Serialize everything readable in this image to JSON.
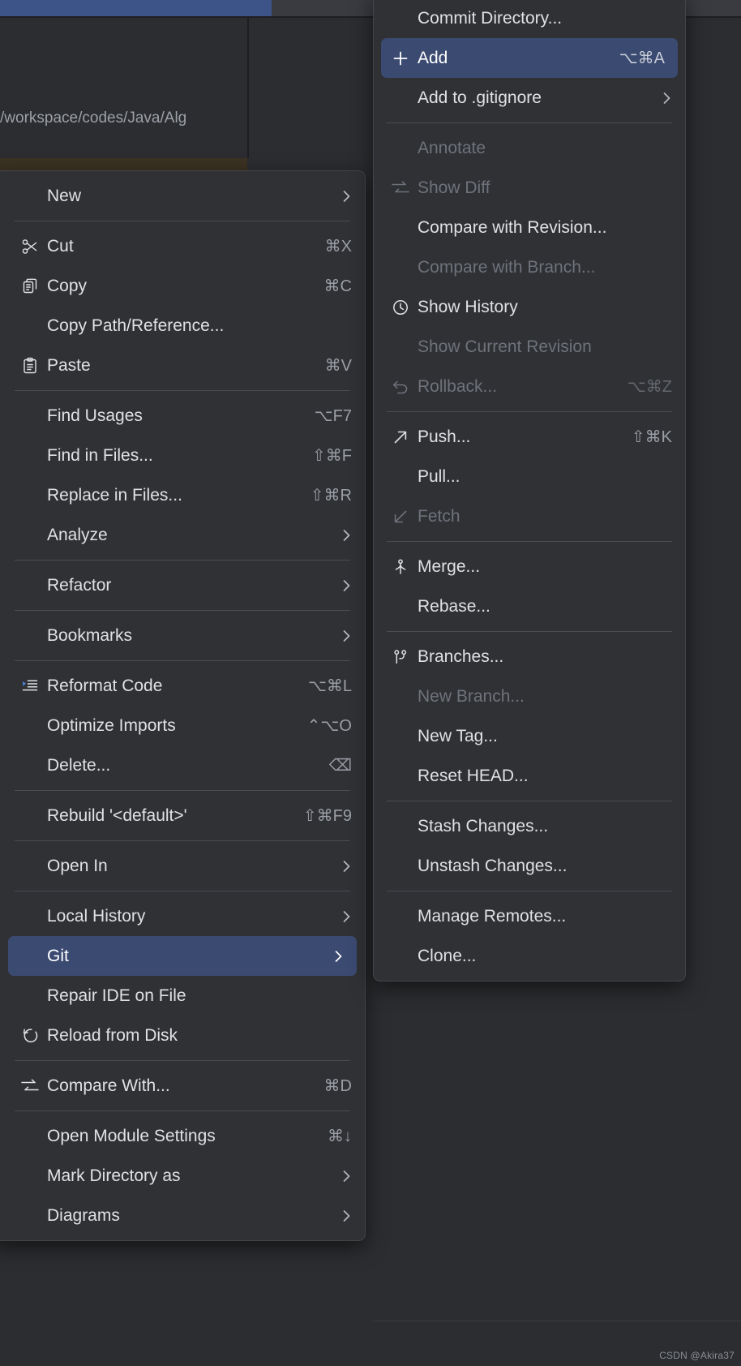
{
  "background": {
    "breadcrumb_path": "/workspace/codes/Java/Alg",
    "watermark": "CSDN @Akira37",
    "accent_color": "#3c5488",
    "editor_bg": "#2b2d30"
  },
  "context_menu": {
    "name": "editor-context-menu",
    "selected_item": "Git",
    "selection_color": "#3b4a71",
    "items": [
      {
        "label": "New",
        "shortcut": "",
        "icon": "",
        "arrow": true,
        "disabled": false,
        "selected": false
      },
      {
        "separator": true
      },
      {
        "label": "Cut",
        "shortcut": "⌘X",
        "icon": "scissors-icon",
        "arrow": false,
        "disabled": false,
        "selected": false
      },
      {
        "label": "Copy",
        "shortcut": "⌘C",
        "icon": "copy-icon",
        "arrow": false,
        "disabled": false,
        "selected": false
      },
      {
        "label": "Copy Path/Reference...",
        "shortcut": "",
        "icon": "",
        "arrow": false,
        "disabled": false,
        "selected": false
      },
      {
        "label": "Paste",
        "shortcut": "⌘V",
        "icon": "paste-icon",
        "arrow": false,
        "disabled": false,
        "selected": false
      },
      {
        "separator": true
      },
      {
        "label": "Find Usages",
        "shortcut": "⌥F7",
        "icon": "",
        "arrow": false,
        "disabled": false,
        "selected": false
      },
      {
        "label": "Find in Files...",
        "shortcut": "⇧⌘F",
        "icon": "",
        "arrow": false,
        "disabled": false,
        "selected": false
      },
      {
        "label": "Replace in Files...",
        "shortcut": "⇧⌘R",
        "icon": "",
        "arrow": false,
        "disabled": false,
        "selected": false
      },
      {
        "label": "Analyze",
        "shortcut": "",
        "icon": "",
        "arrow": true,
        "disabled": false,
        "selected": false
      },
      {
        "separator": true
      },
      {
        "label": "Refactor",
        "shortcut": "",
        "icon": "",
        "arrow": true,
        "disabled": false,
        "selected": false
      },
      {
        "separator": true
      },
      {
        "label": "Bookmarks",
        "shortcut": "",
        "icon": "",
        "arrow": true,
        "disabled": false,
        "selected": false
      },
      {
        "separator": true
      },
      {
        "label": "Reformat Code",
        "shortcut": "⌥⌘L",
        "icon": "reformat-icon",
        "arrow": false,
        "disabled": false,
        "selected": false
      },
      {
        "label": "Optimize Imports",
        "shortcut": "⌃⌥O",
        "icon": "",
        "arrow": false,
        "disabled": false,
        "selected": false
      },
      {
        "label": "Delete...",
        "shortcut": "⌫",
        "icon": "",
        "arrow": false,
        "disabled": false,
        "selected": false
      },
      {
        "separator": true
      },
      {
        "label": "Rebuild '<default>'",
        "shortcut": "⇧⌘F9",
        "icon": "",
        "arrow": false,
        "disabled": false,
        "selected": false
      },
      {
        "separator": true
      },
      {
        "label": "Open In",
        "shortcut": "",
        "icon": "",
        "arrow": true,
        "disabled": false,
        "selected": false
      },
      {
        "separator": true
      },
      {
        "label": "Local History",
        "shortcut": "",
        "icon": "",
        "arrow": true,
        "disabled": false,
        "selected": false
      },
      {
        "label": "Git",
        "shortcut": "",
        "icon": "",
        "arrow": true,
        "disabled": false,
        "selected": true
      },
      {
        "label": "Repair IDE on File",
        "shortcut": "",
        "icon": "",
        "arrow": false,
        "disabled": false,
        "selected": false
      },
      {
        "label": "Reload from Disk",
        "shortcut": "",
        "icon": "reload-icon",
        "arrow": false,
        "disabled": false,
        "selected": false
      },
      {
        "separator": true
      },
      {
        "label": "Compare With...",
        "shortcut": "⌘D",
        "icon": "diff-icon",
        "arrow": false,
        "disabled": false,
        "selected": false
      },
      {
        "separator": true
      },
      {
        "label": "Open Module Settings",
        "shortcut": "⌘↓",
        "icon": "",
        "arrow": false,
        "disabled": false,
        "selected": false
      },
      {
        "label": "Mark Directory as",
        "shortcut": "",
        "icon": "",
        "arrow": true,
        "disabled": false,
        "selected": false
      },
      {
        "label": "Diagrams",
        "shortcut": "",
        "icon": "",
        "arrow": true,
        "disabled": false,
        "selected": false
      }
    ]
  },
  "git_submenu": {
    "name": "git-submenu",
    "selected_item": "Add",
    "selection_color": "#3b4a71",
    "items": [
      {
        "label": "Commit Directory...",
        "shortcut": "",
        "icon": "",
        "arrow": false,
        "disabled": false,
        "selected": false
      },
      {
        "label": "Add",
        "shortcut": "⌥⌘A",
        "icon": "plus-icon",
        "arrow": false,
        "disabled": false,
        "selected": true
      },
      {
        "label": "Add to .gitignore",
        "shortcut": "",
        "icon": "",
        "arrow": true,
        "disabled": false,
        "selected": false
      },
      {
        "separator": true
      },
      {
        "label": "Annotate",
        "shortcut": "",
        "icon": "",
        "arrow": false,
        "disabled": true,
        "selected": false
      },
      {
        "label": "Show Diff",
        "shortcut": "",
        "icon": "diff-icon",
        "arrow": false,
        "disabled": true,
        "selected": false
      },
      {
        "label": "Compare with Revision...",
        "shortcut": "",
        "icon": "",
        "arrow": false,
        "disabled": false,
        "selected": false
      },
      {
        "label": "Compare with Branch...",
        "shortcut": "",
        "icon": "",
        "arrow": false,
        "disabled": true,
        "selected": false
      },
      {
        "label": "Show History",
        "shortcut": "",
        "icon": "clock-icon",
        "arrow": false,
        "disabled": false,
        "selected": false
      },
      {
        "label": "Show Current Revision",
        "shortcut": "",
        "icon": "",
        "arrow": false,
        "disabled": true,
        "selected": false
      },
      {
        "label": "Rollback...",
        "shortcut": "⌥⌘Z",
        "icon": "rollback-icon",
        "arrow": false,
        "disabled": true,
        "selected": false
      },
      {
        "separator": true
      },
      {
        "label": "Push...",
        "shortcut": "⇧⌘K",
        "icon": "push-icon",
        "arrow": false,
        "disabled": false,
        "selected": false
      },
      {
        "label": "Pull...",
        "shortcut": "",
        "icon": "",
        "arrow": false,
        "disabled": false,
        "selected": false
      },
      {
        "label": "Fetch",
        "shortcut": "",
        "icon": "fetch-icon",
        "arrow": false,
        "disabled": true,
        "selected": false
      },
      {
        "separator": true
      },
      {
        "label": "Merge...",
        "shortcut": "",
        "icon": "merge-icon",
        "arrow": false,
        "disabled": false,
        "selected": false
      },
      {
        "label": "Rebase...",
        "shortcut": "",
        "icon": "",
        "arrow": false,
        "disabled": false,
        "selected": false
      },
      {
        "separator": true
      },
      {
        "label": "Branches...",
        "shortcut": "",
        "icon": "branch-icon",
        "arrow": false,
        "disabled": false,
        "selected": false
      },
      {
        "label": "New Branch...",
        "shortcut": "",
        "icon": "",
        "arrow": false,
        "disabled": true,
        "selected": false
      },
      {
        "label": "New Tag...",
        "shortcut": "",
        "icon": "",
        "arrow": false,
        "disabled": false,
        "selected": false
      },
      {
        "label": "Reset HEAD...",
        "shortcut": "",
        "icon": "",
        "arrow": false,
        "disabled": false,
        "selected": false
      },
      {
        "separator": true
      },
      {
        "label": "Stash Changes...",
        "shortcut": "",
        "icon": "",
        "arrow": false,
        "disabled": false,
        "selected": false
      },
      {
        "label": "Unstash Changes...",
        "shortcut": "",
        "icon": "",
        "arrow": false,
        "disabled": false,
        "selected": false
      },
      {
        "separator": true
      },
      {
        "label": "Manage Remotes...",
        "shortcut": "",
        "icon": "",
        "arrow": false,
        "disabled": false,
        "selected": false
      },
      {
        "label": "Clone...",
        "shortcut": "",
        "icon": "",
        "arrow": false,
        "disabled": false,
        "selected": false
      }
    ]
  }
}
